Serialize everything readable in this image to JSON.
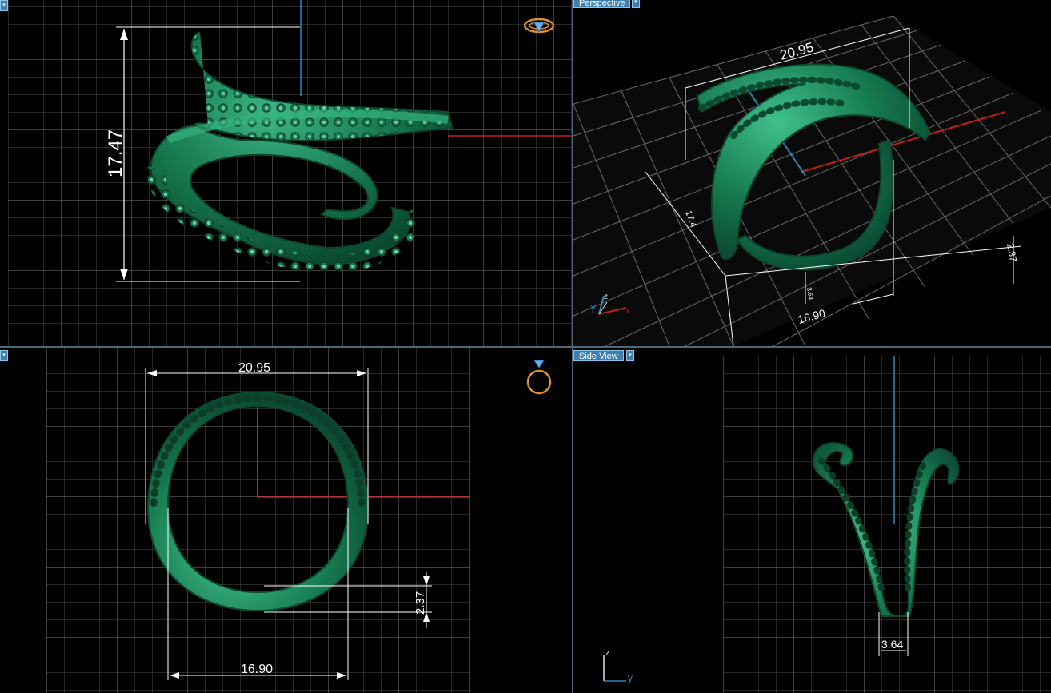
{
  "viewports": {
    "top_left": {
      "dim_height": "17.47",
      "icon": "ring-top-icon"
    },
    "top_right": {
      "label": "Perspective",
      "dim_width": "20.95",
      "dim_height": "17.4",
      "dim_thickness": "2.37",
      "dim_depth": "16.90",
      "dim_band": "3.64",
      "axis_x": "x",
      "axis_y": "y",
      "axis_z": "z"
    },
    "bottom_left": {
      "dim_width": "20.95",
      "dim_inner": "16.90",
      "dim_thickness": "2.37",
      "icon": "ring-front-icon"
    },
    "bottom_right": {
      "label": "Side View",
      "dim_band": "3.64",
      "axis_y": "y",
      "axis_z": "z"
    }
  },
  "colors": {
    "background": "#000000",
    "grid": "#5a5a5a",
    "model": "#1e8a5e",
    "axis_red": "#c0201a",
    "axis_blue": "#2a8ab8",
    "tab": "#3d7fb3"
  }
}
